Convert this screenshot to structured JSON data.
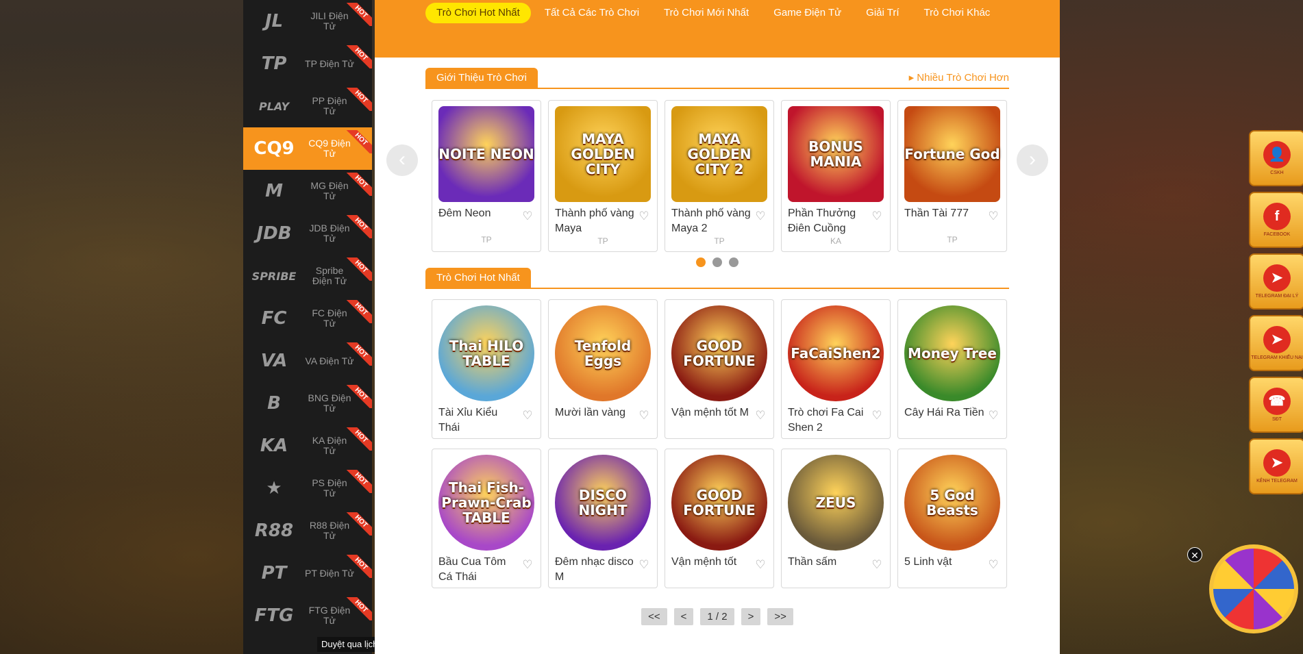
{
  "sidebar": {
    "items": [
      {
        "logo": "JL",
        "label": "JILI Điện Tử",
        "hot": "HOT",
        "active": false
      },
      {
        "logo": "TP",
        "label": "TP Điện Tử",
        "hot": "HOT",
        "active": false
      },
      {
        "logo": "PLAY",
        "label": "PP Điện Tử",
        "hot": "HOT",
        "active": false
      },
      {
        "logo": "CQ9",
        "label": "CQ9 Điện Tử",
        "hot": "HOT",
        "active": true
      },
      {
        "logo": "M",
        "label": "MG Điện Tử",
        "hot": "HOT",
        "active": false
      },
      {
        "logo": "JDB",
        "label": "JDB Điện Tử",
        "hot": "HOT",
        "active": false
      },
      {
        "logo": "SPRIBE",
        "label": "Spribe Điện Tử",
        "hot": "HOT",
        "active": false
      },
      {
        "logo": "FC",
        "label": "FC Điện Tử",
        "hot": "HOT",
        "active": false
      },
      {
        "logo": "VA",
        "label": "VA Điện Tử",
        "hot": "HOT",
        "active": false
      },
      {
        "logo": "B",
        "label": "BNG Điện Tử",
        "hot": "HOT",
        "active": false
      },
      {
        "logo": "KA",
        "label": "KA Điện Tử",
        "hot": "HOT",
        "active": false
      },
      {
        "logo": "★",
        "label": "PS Điện Tử",
        "hot": "HOT",
        "active": false
      },
      {
        "logo": "R88",
        "label": "R88 Điện Tử",
        "hot": "HOT",
        "active": false
      },
      {
        "logo": "PT",
        "label": "PT Điện Tử",
        "hot": "HOT",
        "active": false
      },
      {
        "logo": "FTG",
        "label": "FTG Điện Tử",
        "hot": "HOT",
        "active": false
      }
    ],
    "footer": "Duyệt qua lịch sử ⏶"
  },
  "topnav": {
    "tabs": [
      "Trò Chơi Hot Nhất",
      "Tất Cả Các Trò Chơi",
      "Trò Chơi Mới Nhất",
      "Game Điện Tử",
      "Giải Trí",
      "Trò Chơi Khác"
    ],
    "active": "Trò Chơi Hot Nhất"
  },
  "intro": {
    "title": "Giới Thiệu Trò Chơi",
    "more": "Nhiều Trò Chơi Hơn",
    "games": [
      {
        "thumb": "NOITE NEON",
        "name": "Đêm Neon",
        "provider": "TP",
        "color": "#6b2bb8"
      },
      {
        "thumb": "MAYA GOLDEN CITY",
        "name": "Thành phố vàng Maya",
        "provider": "TP",
        "color": "#d89a12"
      },
      {
        "thumb": "MAYA GOLDEN CITY 2",
        "name": "Thành phố vàng Maya 2",
        "provider": "TP",
        "color": "#d89a12"
      },
      {
        "thumb": "BONUS MANIA",
        "name": "Phần Thưởng Điên Cuồng",
        "provider": "KA",
        "color": "#c0152c"
      },
      {
        "thumb": "Fortune God",
        "name": "Thần Tài 777",
        "provider": "TP",
        "color": "#c54a12"
      }
    ],
    "dots": 3
  },
  "hot": {
    "title": "Trò Chơi Hot Nhất",
    "games": [
      {
        "thumb": "Thai HILO TABLE",
        "name": "Tài Xỉu Kiểu Thái",
        "color": "#5aa7d8"
      },
      {
        "thumb": "Tenfold Eggs",
        "name": "Mười lần vàng",
        "color": "#e0772a"
      },
      {
        "thumb": "GOOD FORTUNE",
        "name": "Vận mệnh tốt M",
        "color": "#8a1a12"
      },
      {
        "thumb": "FaCaiShen2",
        "name": "Trò chơi Fa Cai Shen 2",
        "color": "#c8231a"
      },
      {
        "thumb": "Money Tree",
        "name": "Cây Hái Ra Tiền",
        "color": "#3a8a2a"
      },
      {
        "thumb": "Thai Fish-Prawn-Crab TABLE",
        "name": "Bầu Cua Tôm Cá Thái",
        "color": "#a848c8"
      },
      {
        "thumb": "DISCO NIGHT",
        "name": "Đêm nhạc disco M",
        "color": "#6a22b0"
      },
      {
        "thumb": "GOOD FORTUNE",
        "name": "Vận mệnh tốt",
        "color": "#8a1a12"
      },
      {
        "thumb": "ZEUS",
        "name": "Thần sấm",
        "color": "#6a5a3a"
      },
      {
        "thumb": "5 God Beasts",
        "name": "5 Linh vật",
        "color": "#c8561a"
      }
    ]
  },
  "pager": {
    "first": "<<",
    "prev": "<",
    "current": "1 / 2",
    "next": ">",
    "last": ">>"
  },
  "floats": [
    {
      "icon": "👤",
      "label": "CSKH"
    },
    {
      "icon": "f",
      "label": "FACEBOOK"
    },
    {
      "icon": "➤",
      "label": "TELEGRAM ĐẠI LÝ"
    },
    {
      "icon": "➤",
      "label": "TELEGRAM KHIẾU NẠI"
    },
    {
      "icon": "☎",
      "label": "SĐT"
    },
    {
      "icon": "➤",
      "label": "KÊNH TELEGRAM"
    }
  ],
  "wheel_close": "✕",
  "heart": "♡",
  "arrows": {
    "left": "‹",
    "right": "›"
  }
}
